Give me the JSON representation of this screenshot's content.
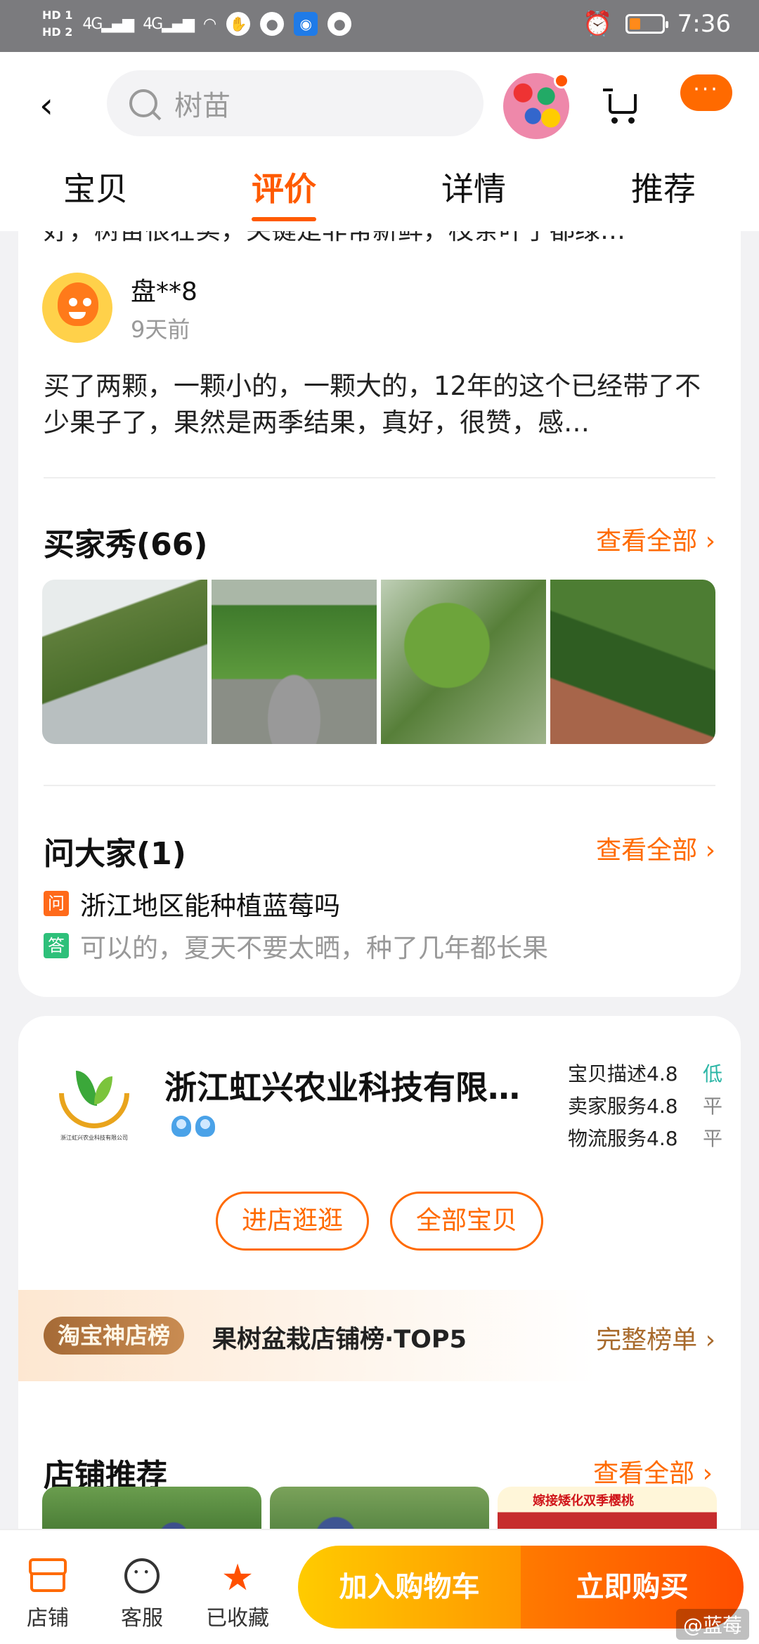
{
  "status_bar": {
    "hd1": "HD 1",
    "hd2": "HD 2",
    "net1": "4G",
    "net2": "4G",
    "time": "7:36"
  },
  "header": {
    "search_placeholder": "树苗",
    "more_label": "···",
    "tabs": [
      {
        "label": "宝贝",
        "active": false
      },
      {
        "label": "评价",
        "active": true
      },
      {
        "label": "详情",
        "active": false
      },
      {
        "label": "推荐",
        "active": false
      }
    ]
  },
  "reviews": {
    "cut_text": "好，树苗很壮实，关键是非常新鲜，枝条叶子都绿…",
    "reviewer_name": "盘**8",
    "review_time": "9天前",
    "review_text": "买了两颗，一颗小的，一颗大的，12年的这个已经带了不少果子了，果然是两季结果，真好，很赞，感…"
  },
  "buyer_show": {
    "title": "买家秀(66)",
    "see_all": "查看全部 ›"
  },
  "ask": {
    "title": "问大家(1)",
    "see_all": "查看全部 ›",
    "q_badge": "问",
    "question": "浙江地区能种植蓝莓吗",
    "a_badge": "答",
    "answer": "可以的，夏天不要太晒，种了几年都长果"
  },
  "shop": {
    "name": "浙江虹兴农业科技有限…",
    "logo_text": "浙江虹兴农业科技有限公司",
    "ratings": [
      {
        "label": "宝贝描述",
        "score": "4.8",
        "level": "低"
      },
      {
        "label": "卖家服务",
        "score": "4.8",
        "level": "平"
      },
      {
        "label": "物流服务",
        "score": "4.8",
        "level": "平"
      }
    ],
    "enter_label": "进店逛逛",
    "all_items_label": "全部宝贝",
    "rank_badge": "淘宝神店榜",
    "rank_text": "果树盆栽店铺榜·TOP5",
    "rank_more": "完整榜单 ›",
    "reco_title": "店铺推荐",
    "reco_more": "查看全部 ›",
    "reco_third_label": "嫁接矮化双季樱桃"
  },
  "bottom_bar": {
    "store_label": "店铺",
    "service_label": "客服",
    "fav_label": "已收藏",
    "add_cart_label": "加入购物车",
    "buy_label": "立即购买",
    "watermark": "@蓝莓"
  }
}
